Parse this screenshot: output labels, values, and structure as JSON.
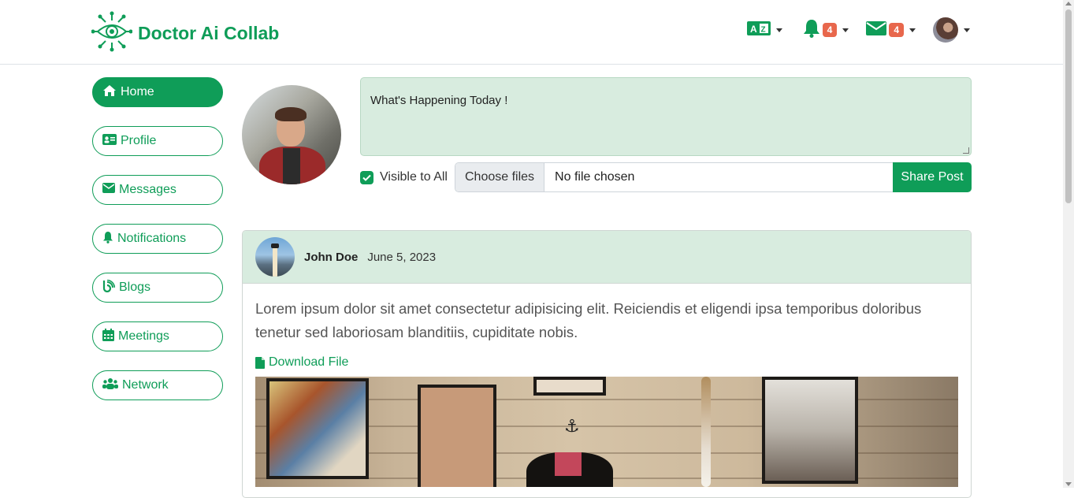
{
  "app": {
    "title": "Doctor Ai Collab"
  },
  "nav": {
    "notifications_count": "4",
    "messages_count": "4"
  },
  "sidebar": {
    "items": [
      {
        "label": "Home",
        "icon": "home-icon",
        "active": true
      },
      {
        "label": "Profile",
        "icon": "id-card-icon",
        "active": false
      },
      {
        "label": "Messages",
        "icon": "envelope-icon",
        "active": false
      },
      {
        "label": "Notifications",
        "icon": "bell-icon",
        "active": false
      },
      {
        "label": "Blogs",
        "icon": "blog-icon",
        "active": false
      },
      {
        "label": "Meetings",
        "icon": "calendar-icon",
        "active": false
      },
      {
        "label": "Network",
        "icon": "users-icon",
        "active": false
      }
    ]
  },
  "composer": {
    "text": "What's Happening Today !",
    "visible_label": "Visible to All",
    "visible_checked": true,
    "choose_files_label": "Choose files",
    "file_status": "No file chosen",
    "share_label": "Share Post"
  },
  "post": {
    "author": "John Doe",
    "date": "June 5, 2023",
    "body": "Lorem ipsum dolor sit amet consectetur adipisicing elit. Reiciendis et eligendi ipsa temporibus doloribus tenetur sed laboriosam blanditiis, cupiditate nobis.",
    "download_label": "Download File"
  },
  "colors": {
    "brand": "#0f9d58",
    "badge": "#e8674c",
    "composer_bg": "#d8ecdf"
  }
}
